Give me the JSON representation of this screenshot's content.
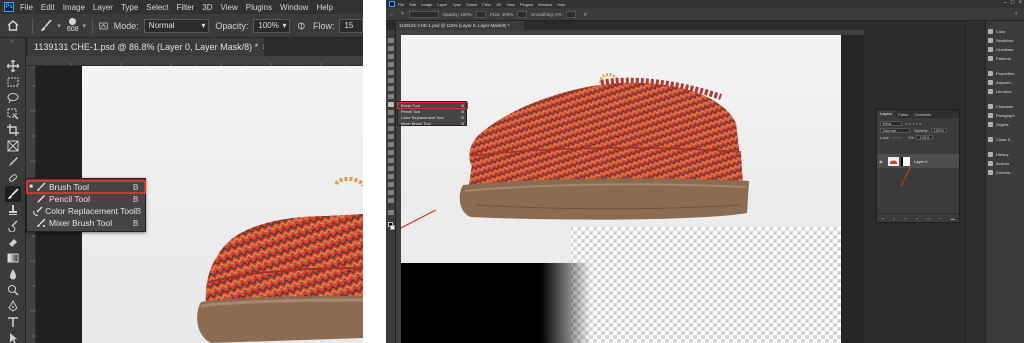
{
  "left": {
    "menu": [
      "File",
      "Edit",
      "Image",
      "Layer",
      "Type",
      "Select",
      "Filter",
      "3D",
      "View",
      "Plugins",
      "Window",
      "Help"
    ],
    "options": {
      "brush_size": "608",
      "mode_label": "Mode:",
      "mode_value": "Normal",
      "opacity_label": "Opacity:",
      "opacity_value": "100%",
      "flow_label": "Flow:",
      "flow_value": "15"
    },
    "document_tab": "1139131 CHE-1.psd @ 86.8% (Layer 0, Layer Mask/8) *",
    "flyout": [
      {
        "label": "Brush Tool",
        "shortcut": "B",
        "active": true
      },
      {
        "label": "Pencil Tool",
        "shortcut": "B",
        "active": false
      },
      {
        "label": "Color Replacement Tool",
        "shortcut": "B",
        "active": false
      },
      {
        "label": "Mixer Brush Tool",
        "shortcut": "B",
        "active": false
      }
    ]
  },
  "right": {
    "menu": [
      "File",
      "Edit",
      "Image",
      "Layer",
      "Type",
      "Select",
      "Filter",
      "3D",
      "View",
      "Plugins",
      "Window",
      "Help"
    ],
    "options": {
      "opacity": "Opacity: 100%",
      "flow": "Flow: 100%",
      "smoothing": "Smoothing: 0%",
      "angle": "0°"
    },
    "document_tab": "1139131 CHE-1.psd @ 115% (Layer 0, Layer Mask/8) *",
    "flyout": [
      {
        "label": "Brush Tool",
        "shortcut": "B"
      },
      {
        "label": "Pencil Tool",
        "shortcut": "B"
      },
      {
        "label": "Color Replacement Tool",
        "shortcut": "B"
      },
      {
        "label": "Mixer Brush Tool",
        "shortcut": "B"
      }
    ],
    "layers_panel": {
      "tabs": [
        "Layers",
        "Paths",
        "Channels"
      ],
      "kind_label": "Kind",
      "blend_mode": "Normal",
      "opacity_label": "Opacity:",
      "opacity_value": "100%",
      "lock_label": "Lock:",
      "fill_label": "Fill:",
      "fill_value": "100%",
      "layer_name": "Layer 0"
    },
    "dock": [
      {
        "label": "Color"
      },
      {
        "label": "Swatches"
      },
      {
        "label": "Gradients"
      },
      {
        "label": "Patterns"
      },
      {
        "label": "Properties"
      },
      {
        "label": "Adjustm..."
      },
      {
        "label": "Libraries"
      },
      {
        "label": "Character"
      },
      {
        "label": "Paragraph"
      },
      {
        "label": "Glyphs"
      },
      {
        "label": "Clone S..."
      },
      {
        "label": "History"
      },
      {
        "label": "Actions"
      },
      {
        "label": "Comme..."
      }
    ]
  },
  "colors": {
    "highlight": "#d9342b",
    "ps_blue": "#31a8ff",
    "ui_dark": "#3b3b3b"
  }
}
